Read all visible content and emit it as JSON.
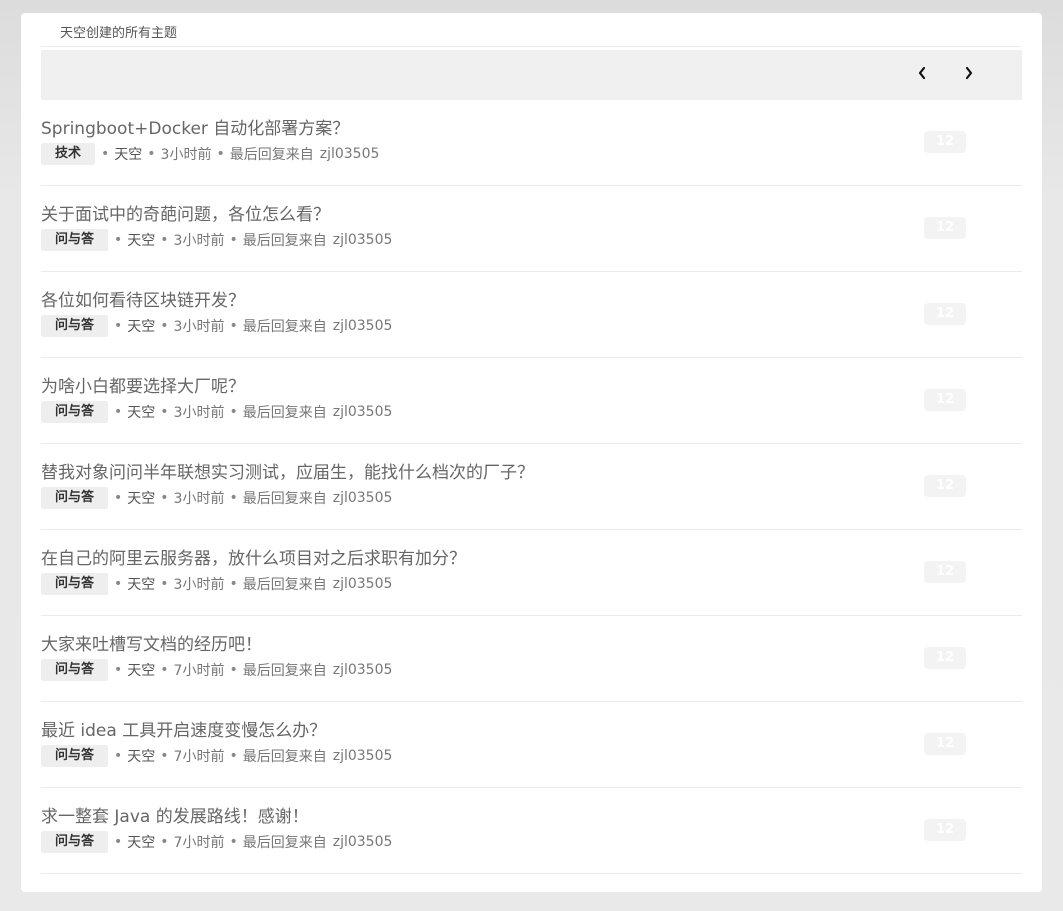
{
  "header": {
    "title": "天空创建的所有主题"
  },
  "pager": {
    "prev_icon": "chevron-left-icon",
    "next_icon": "chevron-right-icon"
  },
  "meta": {
    "dot": "•",
    "last_reply_prefix": "最后回复来自"
  },
  "topics": [
    {
      "title": "Springboot+Docker 自动化部署方案？",
      "tag": "技术",
      "author": "天空",
      "time": "3小时前",
      "last_user": "zjl03505",
      "replies": "12"
    },
    {
      "title": "关于面试中的奇葩问题，各位怎么看？",
      "tag": "问与答",
      "author": "天空",
      "time": "3小时前",
      "last_user": "zjl03505",
      "replies": "12"
    },
    {
      "title": "各位如何看待区块链开发？",
      "tag": "问与答",
      "author": "天空",
      "time": "3小时前",
      "last_user": "zjl03505",
      "replies": "12"
    },
    {
      "title": "为啥小白都要选择大厂呢？",
      "tag": "问与答",
      "author": "天空",
      "time": "3小时前",
      "last_user": "zjl03505",
      "replies": "12"
    },
    {
      "title": "替我对象问问半年联想实习测试，应届生，能找什么档次的厂子？",
      "tag": "问与答",
      "author": "天空",
      "time": "3小时前",
      "last_user": "zjl03505",
      "replies": "12"
    },
    {
      "title": "在自己的阿里云服务器，放什么项目对之后求职有加分？",
      "tag": "问与答",
      "author": "天空",
      "time": "3小时前",
      "last_user": "zjl03505",
      "replies": "12"
    },
    {
      "title": "大家来吐槽写文档的经历吧！",
      "tag": "问与答",
      "author": "天空",
      "time": "7小时前",
      "last_user": "zjl03505",
      "replies": "12"
    },
    {
      "title": "最近 idea 工具开启速度变慢怎么办？",
      "tag": "问与答",
      "author": "天空",
      "time": "7小时前",
      "last_user": "zjl03505",
      "replies": "12"
    },
    {
      "title": "求一整套 Java 的发展路线！感谢！",
      "tag": "问与答",
      "author": "天空",
      "time": "7小时前",
      "last_user": "zjl03505",
      "replies": "12"
    }
  ]
}
